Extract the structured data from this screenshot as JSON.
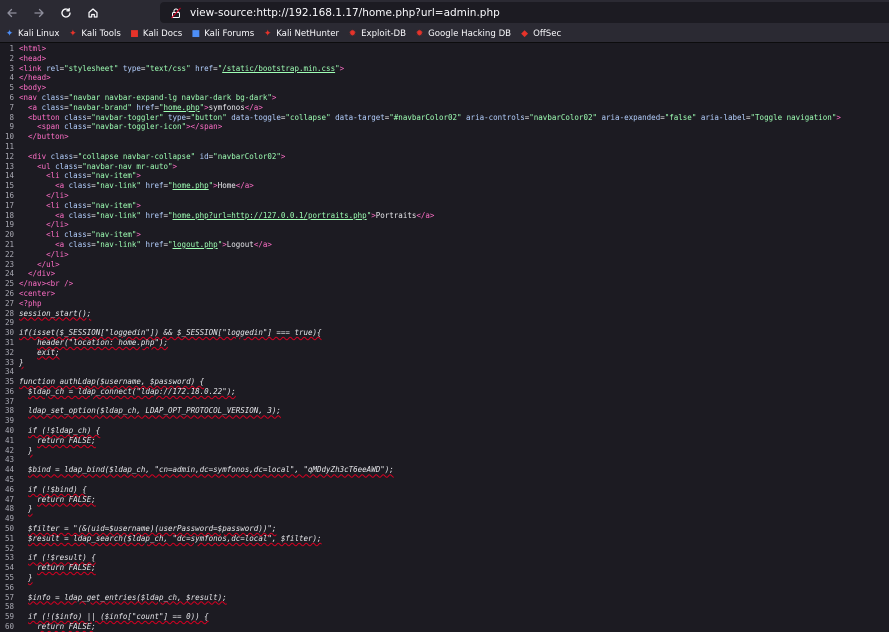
{
  "toolbar": {
    "url": "view-source:http://192.168.1.17/home.php?url=admin.php"
  },
  "bookmarks": [
    {
      "label": "Kali Linux",
      "icon": "kali-dragon-icon",
      "color": "#4d8ef7"
    },
    {
      "label": "Kali Tools",
      "icon": "kali-tools-icon",
      "color": "#e6332a"
    },
    {
      "label": "Kali Docs",
      "icon": "kali-docs-icon",
      "color": "#e6332a"
    },
    {
      "label": "Kali Forums",
      "icon": "kali-forums-icon",
      "color": "#4d8ef7"
    },
    {
      "label": "Kali NetHunter",
      "icon": "nethunter-icon",
      "color": "#e6332a"
    },
    {
      "label": "Exploit-DB",
      "icon": "exploitdb-icon",
      "color": "#e6332a"
    },
    {
      "label": "Google Hacking DB",
      "icon": "ghdb-icon",
      "color": "#e6332a"
    },
    {
      "label": "OffSec",
      "icon": "offsec-icon",
      "color": "#e6332a"
    }
  ],
  "source_lines": [
    "<html>",
    "<head>",
    "<link rel=\"stylesheet\" type=\"text/css\" href=\"/static/bootstrap.min.css\">",
    "</head>",
    "<body>",
    "<nav class=\"navbar navbar-expand-lg navbar-dark bg-dark\">",
    "  <a class=\"navbar-brand\" href=\"home.php\">symfonos</a>",
    "  <button class=\"navbar-toggler\" type=\"button\" data-toggle=\"collapse\" data-target=\"#navbarColor02\" aria-controls=\"navbarColor02\" aria-expanded=\"false\" aria-label=\"Toggle navigation\">",
    "    <span class=\"navbar-toggler-icon\"></span>",
    "  </button>",
    "",
    "  <div class=\"collapse navbar-collapse\" id=\"navbarColor02\">",
    "    <ul class=\"navbar-nav mr-auto\">",
    "      <li class=\"nav-item\">",
    "        <a class=\"nav-link\" href=\"home.php\">Home</a>",
    "      </li>",
    "      <li class=\"nav-item\">",
    "        <a class=\"nav-link\" href=\"home.php?url=http://127.0.0.1/portraits.php\">Portraits</a>",
    "      </li>",
    "      <li class=\"nav-item\">",
    "        <a class=\"nav-link\" href=\"logout.php\">Logout</a>",
    "      </li>",
    "    </ul>",
    "  </div>",
    "</nav><br />",
    "<center>",
    "<?php",
    "session_start();",
    "",
    "if(isset($_SESSION[\"loggedin\"]) && $_SESSION[\"loggedin\"] === true){",
    "    header(\"location: home.php\");",
    "    exit;",
    "}",
    "",
    "function authLdap($username, $password) {",
    "  $ldap_ch = ldap_connect(\"ldap://172.18.0.22\");",
    "",
    "  ldap_set_option($ldap_ch, LDAP_OPT_PROTOCOL_VERSION, 3);",
    "",
    "  if (!$ldap_ch) {",
    "    return FALSE;",
    "  }",
    "",
    "  $bind = ldap_bind($ldap_ch, \"cn=admin,dc=symfonos,dc=local\", \"qMDdyZh3cT6eeAWD\");",
    "",
    "  if (!$bind) {",
    "    return FALSE;",
    "  }",
    "",
    "  $filter = \"(&(uid=$username)(userPassword=$password))\";",
    "  $result = ldap_search($ldap_ch, \"dc=symfonos,dc=local\", $filter);",
    "",
    "  if (!$result) {",
    "    return FALSE;",
    "  }",
    "",
    "  $info = ldap_get_entries($ldap_ch, $result);",
    "",
    "  if (!($info) || ($info[\"count\"] == 0)) {",
    "    return FALSE;",
    "  }"
  ]
}
